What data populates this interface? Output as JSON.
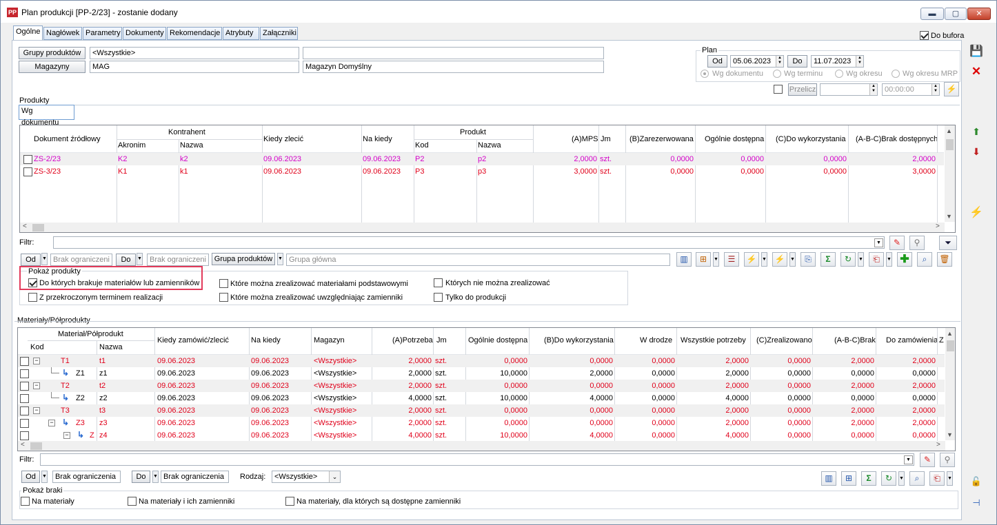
{
  "window": {
    "title": "Plan produkcji [PP-2/23] - zostanie dodany",
    "icon": "PP",
    "controls": {
      "minimize": "▬",
      "maximize": "▢",
      "close": "✕"
    }
  },
  "tabs": [
    "Ogólne",
    "Nagłówek",
    "Parametry",
    "Dokumenty",
    "Rekomendacje",
    "Atrybuty",
    "Załączniki"
  ],
  "do_bufora": "Do bufora",
  "filters": {
    "grupy_btn": "Grupy produktów",
    "grupy_value": "<Wszystkie>",
    "grupy_desc": "",
    "magazyny_btn": "Magazyny",
    "magazyny_value": "MAG",
    "magazyny_desc": "Magazyn Domyślny"
  },
  "plan": {
    "label": "Plan",
    "od_btn": "Od",
    "od_value": "05.06.2023",
    "do_btn": "Do",
    "do_value": "11.07.2023",
    "radios": [
      "Wg dokumentu",
      "Wg terminu",
      "Wg okresu",
      "Wg okresu MRP"
    ],
    "przelicz": "Przelicz",
    "time": "00:00:00"
  },
  "produkty": {
    "label": "Produkty",
    "subtab": "Wg dokumentu",
    "headers": {
      "dok": "Dokument źródłowy",
      "kontrahent": "Kontrahent",
      "akronim": "Akronim",
      "nazwa": "Nazwa",
      "kiedy": "Kiedy zlecić",
      "na_kiedy": "Na kiedy",
      "produkt": "Produkt",
      "kod": "Kod",
      "pnazwa": "Nazwa",
      "mps": "(A)MPS",
      "jm": "Jm",
      "zarez": "(B)Zarezerwowana",
      "ogolnie": "Ogólnie dostępna",
      "dowyk": "(C)Do wykorzystania",
      "brak": "(A-B-C)Brak dostępnych"
    },
    "rows": [
      {
        "dok": "ZS-2/23",
        "akronim": "K2",
        "nazwa": "k2",
        "kiedy": "09.06.2023",
        "na_kiedy": "09.06.2023",
        "kod": "P2",
        "pnazwa": "p2",
        "mps": "2,0000",
        "jm": "szt.",
        "zarez": "0,0000",
        "ogolnie": "0,0000",
        "dowyk": "0,0000",
        "brak": "2,0000"
      },
      {
        "dok": "ZS-3/23",
        "akronim": "K1",
        "nazwa": "k1",
        "kiedy": "09.06.2023",
        "na_kiedy": "09.06.2023",
        "kod": "P3",
        "pnazwa": "p3",
        "mps": "3,0000",
        "jm": "szt.",
        "zarez": "0,0000",
        "ogolnie": "0,0000",
        "dowyk": "0,0000",
        "brak": "3,0000"
      }
    ],
    "filtr_label": "Filtr:",
    "od": "Od",
    "od_ph": "Brak ograniczeni",
    "do": "Do",
    "do_ph": "Brak ograniczeni",
    "grupa_btn": "Grupa produktów",
    "grupa_ph": "Grupa główna",
    "pokaz": {
      "label": "Pokaż produkty",
      "opt1": "Do których brakuje materiałów lub zamienników",
      "opt2": "Z przekroczonym terminem realizacji",
      "opt3": "Które można zrealizować materiałami podstawowymi",
      "opt4": "Które można zrealizować uwzględniając zamienniki",
      "opt5": "Których nie można zrealizować",
      "opt6": "Tylko do produkcji"
    }
  },
  "materialy": {
    "label": "Materiały/Półprodukty",
    "headers": {
      "mat": "Materiał/Półprodukt",
      "kod": "Kod",
      "nazwa": "Nazwa",
      "kiedy": "Kiedy zamówić/zlecić",
      "na_kiedy": "Na kiedy",
      "magazyn": "Magazyn",
      "potrzeba": "(A)Potrzeba",
      "jm": "Jm",
      "ogolnie": "Ogólnie dostępna",
      "dowyk": "(B)Do wykorzystania",
      "wdrodze": "W drodze",
      "wszystkie": "Wszystkie potrzeby",
      "zreal": "(C)Zrealizowano",
      "brak": "(A-B-C)Brak",
      "dozam": "Do zamówienia",
      "extra": "Z"
    },
    "rows": [
      {
        "kod": "T1",
        "nazwa": "t1",
        "kiedy": "09.06.2023",
        "na_kiedy": "09.06.2023",
        "magazyn": "<Wszystkie>",
        "potrzeba": "2,0000",
        "jm": "szt.",
        "ogolnie": "0,0000",
        "dowyk": "0,0000",
        "wdrodze": "0,0000",
        "wszystkie": "2,0000",
        "zreal": "0,0000",
        "brak": "2,0000",
        "dozam": "2,0000"
      },
      {
        "kod": "Z1",
        "nazwa": "z1",
        "kiedy": "09.06.2023",
        "na_kiedy": "09.06.2023",
        "magazyn": "<Wszystkie>",
        "potrzeba": "2,0000",
        "jm": "szt.",
        "ogolnie": "10,0000",
        "dowyk": "2,0000",
        "wdrodze": "0,0000",
        "wszystkie": "2,0000",
        "zreal": "0,0000",
        "brak": "0,0000",
        "dozam": "0,0000"
      },
      {
        "kod": "T2",
        "nazwa": "t2",
        "kiedy": "09.06.2023",
        "na_kiedy": "09.06.2023",
        "magazyn": "<Wszystkie>",
        "potrzeba": "2,0000",
        "jm": "szt.",
        "ogolnie": "0,0000",
        "dowyk": "0,0000",
        "wdrodze": "0,0000",
        "wszystkie": "2,0000",
        "zreal": "0,0000",
        "brak": "2,0000",
        "dozam": "2,0000"
      },
      {
        "kod": "Z2",
        "nazwa": "z2",
        "kiedy": "09.06.2023",
        "na_kiedy": "09.06.2023",
        "magazyn": "<Wszystkie>",
        "potrzeba": "4,0000",
        "jm": "szt.",
        "ogolnie": "10,0000",
        "dowyk": "4,0000",
        "wdrodze": "0,0000",
        "wszystkie": "4,0000",
        "zreal": "0,0000",
        "brak": "0,0000",
        "dozam": "0,0000"
      },
      {
        "kod": "T3",
        "nazwa": "t3",
        "kiedy": "09.06.2023",
        "na_kiedy": "09.06.2023",
        "magazyn": "<Wszystkie>",
        "potrzeba": "2,0000",
        "jm": "szt.",
        "ogolnie": "0,0000",
        "dowyk": "0,0000",
        "wdrodze": "0,0000",
        "wszystkie": "2,0000",
        "zreal": "0,0000",
        "brak": "2,0000",
        "dozam": "2,0000"
      },
      {
        "kod": "Z3",
        "nazwa": "z3",
        "kiedy": "09.06.2023",
        "na_kiedy": "09.06.2023",
        "magazyn": "<Wszystkie>",
        "potrzeba": "2,0000",
        "jm": "szt.",
        "ogolnie": "0,0000",
        "dowyk": "0,0000",
        "wdrodze": "0,0000",
        "wszystkie": "2,0000",
        "zreal": "0,0000",
        "brak": "2,0000",
        "dozam": "2,0000"
      },
      {
        "kod": "Z",
        "nazwa": "z4",
        "kiedy": "09.06.2023",
        "na_kiedy": "09.06.2023",
        "magazyn": "<Wszystkie>",
        "potrzeba": "4,0000",
        "jm": "szt.",
        "ogolnie": "10,0000",
        "dowyk": "4,0000",
        "wdrodze": "0,0000",
        "wszystkie": "4,0000",
        "zreal": "0,0000",
        "brak": "0,0000",
        "dozam": "0,0000"
      }
    ],
    "filtr_label": "Filtr:",
    "od": "Od",
    "od_val": "Brak ograniczenia",
    "do": "Do",
    "do_val": "Brak ograniczenia",
    "rodzaj_label": "Rodzaj:",
    "rodzaj_val": "<Wszystkie>",
    "pokaz": {
      "label": "Pokaż braki",
      "opt1": "Na materiały",
      "opt2": "Na materiały i ich zamienniki",
      "opt3": "Na materiały, dla których są dostępne zamienniki"
    }
  }
}
